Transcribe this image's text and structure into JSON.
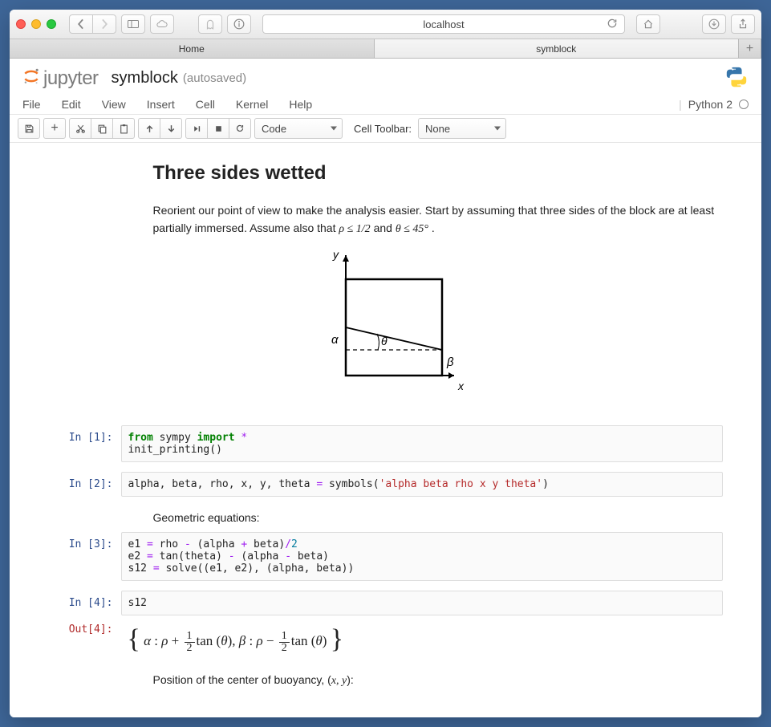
{
  "safari": {
    "address": "localhost",
    "tabs": [
      "Home",
      "symblock"
    ],
    "active_tab": 1
  },
  "jupyter": {
    "logo_text": "jupyter",
    "notebook_name": "symblock",
    "save_status": "(autosaved)",
    "kernel_label": "Python 2",
    "menu": [
      "File",
      "Edit",
      "View",
      "Insert",
      "Cell",
      "Kernel",
      "Help"
    ],
    "toolbar": {
      "cell_type": "Code",
      "cell_toolbar_label": "Cell Toolbar:",
      "cell_toolbar_value": "None"
    }
  },
  "content": {
    "heading": "Three sides wetted",
    "intro_pre": "Reorient our point of view to make the analysis easier. Start by assuming that three sides of the block are at least partially immersed. Assume also that ",
    "intro_mid": " and ",
    "intro_post": ".",
    "rho_cond": "ρ ≤ 1/2",
    "theta_cond": "θ ≤ 45°",
    "diagram": {
      "y": "y",
      "x": "x",
      "alpha": "α",
      "beta": "β",
      "theta": "θ"
    },
    "geo_label": "Geometric equations:",
    "buoy_label_pre": "Position of the center of buoyancy, (",
    "buoy_xy": "x, y",
    "buoy_label_post": "):"
  },
  "cells": {
    "c1": {
      "prompt": "In [1]:"
    },
    "c2": {
      "prompt": "In [2]:",
      "sym_str": "'alpha beta rho x y theta'"
    },
    "c3": {
      "prompt": "In [3]:"
    },
    "c4": {
      "prompt_in": "In [4]:",
      "prompt_out": "Out[4]:",
      "code": "s12"
    },
    "out4": {
      "alpha": "α",
      "beta": "β",
      "rho": "ρ",
      "theta": "θ",
      "tan": "tan",
      "colon": " : ",
      "comma": ",   "
    }
  }
}
